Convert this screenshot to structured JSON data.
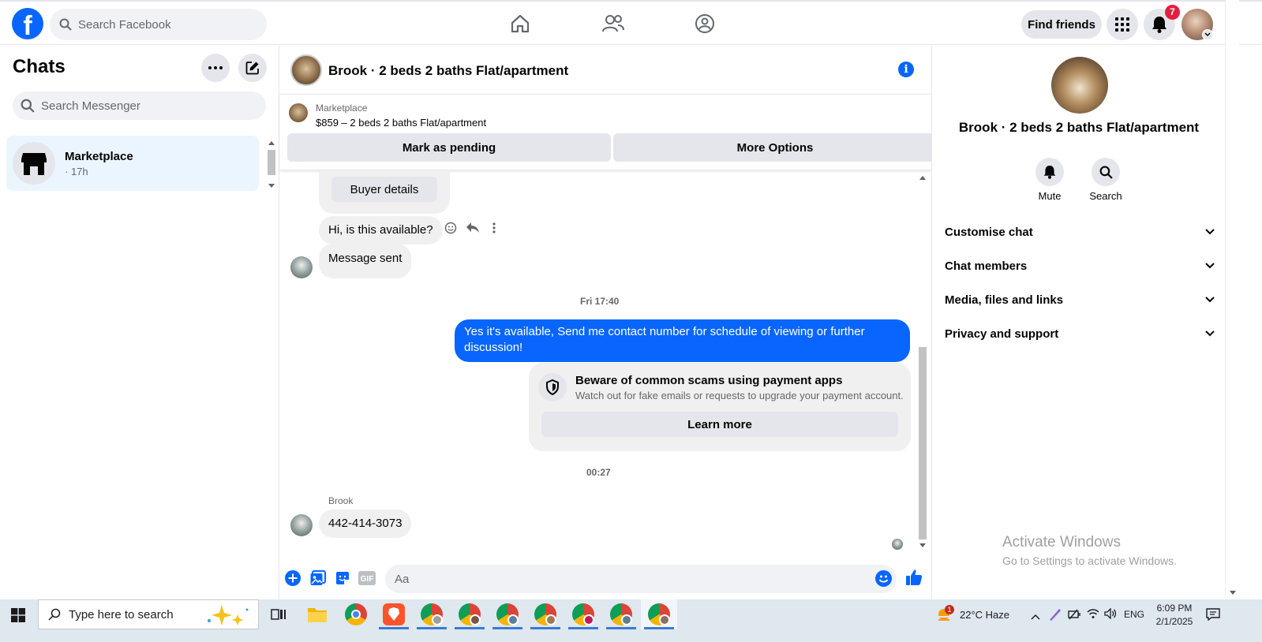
{
  "topbar": {
    "search_placeholder": "Search Facebook",
    "find_friends": "Find friends",
    "notification_count": "7",
    "icons": [
      "facebook-logo",
      "home-icon",
      "friends-icon",
      "groups-icon",
      "menu-grid-icon",
      "bell-icon"
    ]
  },
  "left": {
    "title": "Chats",
    "search_placeholder": "Search Messenger",
    "chats": [
      {
        "name": "Marketplace",
        "time": "· 17h"
      }
    ]
  },
  "conversation": {
    "title": "Brook · 2 beds 2 baths Flat/apartment",
    "listing": {
      "label": "Marketplace",
      "price_title": "$859 – 2 beds 2 baths Flat/apartment",
      "mark_pending": "Mark as pending",
      "more_options": "More Options"
    },
    "messages": {
      "buyer_details": "Buyer details",
      "question": "Hi, is this available?",
      "message_sent": "Message sent",
      "timestamp1": "Fri 17:40",
      "reply": "Yes it's available, Send me contact number for schedule of viewing or further discussion!",
      "scam_title": "Beware of common scams using payment apps",
      "scam_desc": "Watch out for fake emails or requests to upgrade your payment account.",
      "learn_more": "Learn more",
      "timestamp2": "00:27",
      "sender_name": "Brook",
      "phone": "442-414-3073"
    },
    "composer_placeholder": "Aa"
  },
  "right": {
    "title": "Brook · 2 beds 2 baths Flat/apartment",
    "actions": {
      "mute": "Mute",
      "search": "Search"
    },
    "sections": [
      "Customise chat",
      "Chat members",
      "Media, files and links",
      "Privacy and support"
    ]
  },
  "watermark": {
    "line1": "Activate Windows",
    "line2": "Go to Settings to activate Windows."
  },
  "taskbar": {
    "search_placeholder": "Type here to search",
    "weather": "22°C  Haze",
    "weather_badge": "1",
    "language": "ENG",
    "time": "6:09 PM",
    "date": "2/1/2025"
  },
  "colors": {
    "brand_blue": "#0866ff",
    "selected_chat_bg": "#ebf5ff",
    "badge_red": "#e41e3f"
  }
}
